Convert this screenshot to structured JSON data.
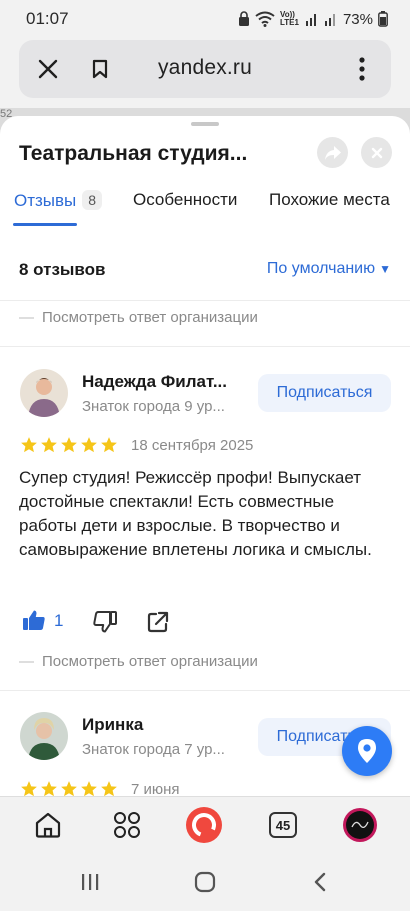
{
  "status_bar": {
    "time": "01:07",
    "battery": "73%",
    "volte_label": "Vo)) LTE1"
  },
  "browser": {
    "url": "yandex.ru",
    "close_icon": "close-icon",
    "bookmark_icon": "bookmark-icon",
    "menu_icon": "more-vert-icon"
  },
  "map_number": "52",
  "sheet": {
    "title": "Театральная студия...",
    "tabs": [
      {
        "label": "Отзывы",
        "badge": "8",
        "active": true
      },
      {
        "label": "Особенности"
      },
      {
        "label": "Похожие места"
      }
    ],
    "reviews_count": "8 отзывов",
    "sort_label": "По умолчанию",
    "org_reply_label": "Посмотреть ответ организации",
    "reviews": [
      {
        "name": "Надежда Филат...",
        "level": "Знаток города 9 ур...",
        "subscribe_label": "Подписаться",
        "rating": 5,
        "date": "18 сентября 2025",
        "text": "Супер студия! Режиссёр профи! Выпускает достойные спектакли! Есть совместные работы дети и взрослые. В творчество и самовыражение вплетены логика и смыслы.",
        "likes": "1",
        "org_reply_label": "Посмотреть ответ организации"
      },
      {
        "name": "Иринка",
        "level": "Знаток города 7 ур...",
        "subscribe_label": "Подписаться",
        "rating": 5,
        "date": "7 июня"
      }
    ]
  },
  "bottom_bar": {
    "tabs_count": "45"
  },
  "colors": {
    "accent": "#2d6bd6",
    "star": "#f5c518",
    "alice": "#f0483e",
    "fab": "#2d7cf6"
  }
}
